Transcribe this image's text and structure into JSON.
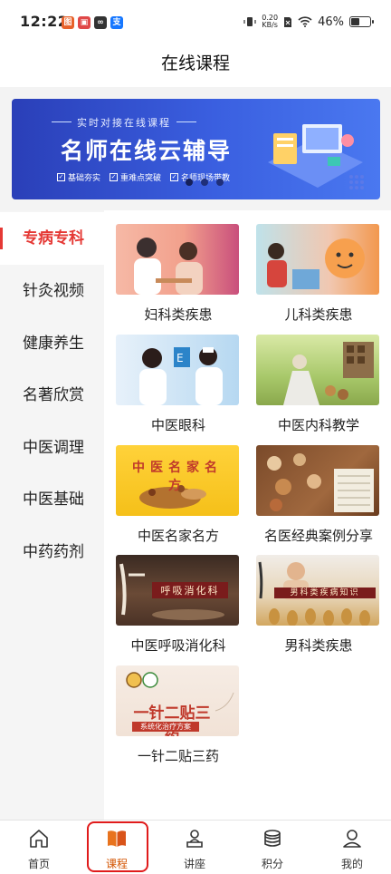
{
  "status_bar": {
    "time": "12:22",
    "net_speed_value": "0.20",
    "net_speed_unit": "KB/s",
    "battery": "46%",
    "battery_level": 0.46
  },
  "header": {
    "title": "在线课程"
  },
  "banner": {
    "subtitle": "实时对接在线课程",
    "title": "名师在线云辅导",
    "features": [
      "基础夯实",
      "重难点突破",
      "名师现场带教"
    ],
    "slide_count": 3,
    "active_slide": 0
  },
  "categories": [
    {
      "label": "专病专科",
      "active": true
    },
    {
      "label": "针灸视频",
      "active": false
    },
    {
      "label": "健康养生",
      "active": false
    },
    {
      "label": "名著欣赏",
      "active": false
    },
    {
      "label": "中医调理",
      "active": false
    },
    {
      "label": "中医基础",
      "active": false
    },
    {
      "label": "中药药剂",
      "active": false
    }
  ],
  "courses": [
    {
      "label": "妇科类疾患"
    },
    {
      "label": "儿科类疾患"
    },
    {
      "label": "中医眼科"
    },
    {
      "label": "中医内科教学"
    },
    {
      "label": "中医名家名方",
      "banner_text": "中医名家名方"
    },
    {
      "label": "名医经典案例分享"
    },
    {
      "label": "中医呼吸消化科",
      "banner_text": "呼吸消化科"
    },
    {
      "label": "男科类疾患",
      "banner_text": "男科类疾病知识"
    },
    {
      "label": "一针二贴三药",
      "banner_text": "一针二贴三药",
      "banner_subtext": "系统化治疗方案"
    }
  ],
  "bottom_nav": [
    {
      "label": "首页",
      "icon": "home-icon",
      "active": false
    },
    {
      "label": "课程",
      "icon": "book-icon",
      "active": true
    },
    {
      "label": "讲座",
      "icon": "lecture-icon",
      "active": false
    },
    {
      "label": "积分",
      "icon": "coins-icon",
      "active": false
    },
    {
      "label": "我的",
      "icon": "user-icon",
      "active": false
    }
  ],
  "colors": {
    "accent": "#e53935",
    "active_tab": "#d35400",
    "banner_blue": "#3a5fe0"
  }
}
